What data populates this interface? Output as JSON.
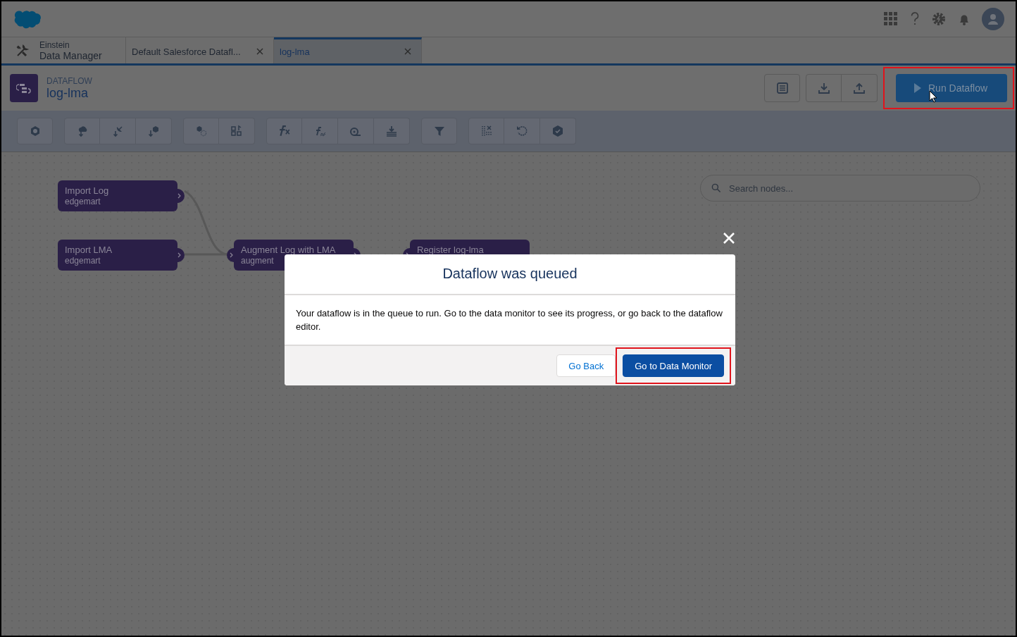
{
  "app_tabs": [
    {
      "kind": "app",
      "line1": "Einstein",
      "line2": "Data Manager"
    },
    {
      "kind": "tab",
      "label": "Default Salesforce Datafl...",
      "selected": false
    },
    {
      "kind": "tab",
      "label": "log-lma",
      "selected": true
    }
  ],
  "header": {
    "eyebrow": "DATAFLOW",
    "title": "log-lma"
  },
  "run_button": {
    "label": "Run Dataflow",
    "highlighted": true
  },
  "search": {
    "placeholder": "Search nodes..."
  },
  "nodes": [
    {
      "title": "Import Log",
      "type": "edgemart"
    },
    {
      "title": "Import LMA",
      "type": "edgemart"
    },
    {
      "title": "Augment Log with LMA",
      "type": "augment"
    },
    {
      "title": "Register log-lma"
    }
  ],
  "modal": {
    "title": "Dataflow was queued",
    "body": "Your dataflow is in the queue to run. Go to the data monitor to see its progress, or go back to the dataflow editor.",
    "buttons": [
      {
        "kind": "neutral",
        "label": "Go Back",
        "highlighted": false
      },
      {
        "kind": "brand",
        "label": "Go to Data Monitor",
        "highlighted": true
      }
    ]
  }
}
